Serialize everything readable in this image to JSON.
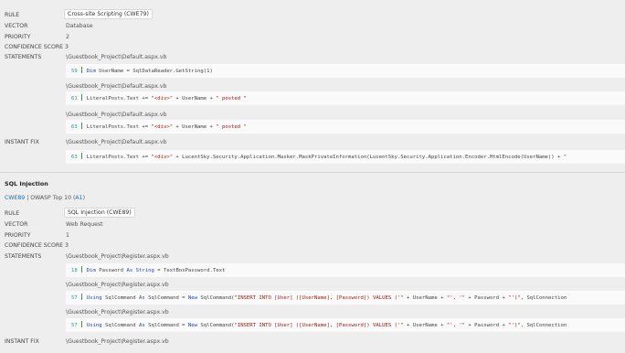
{
  "section1": {
    "rule_label": "RULE",
    "rule_value": "Cross-site Scripting (CWE79)",
    "vector_label": "VECTOR",
    "vector_value": "Database",
    "priority_label": "PRIORITY",
    "priority_value": "2",
    "confidence_label": "CONFIDENCE SCORE",
    "confidence_value": "3",
    "statements_label": "STATEMENTS",
    "statements": [
      {
        "path": "\\Guestbook_Project\\Default.aspx.vb",
        "line": "59",
        "parts": [
          {
            "t": "kw",
            "v": "Dim"
          },
          {
            "t": "txt",
            "v": " UserName = SqlDataReader.GetString(1)"
          }
        ]
      },
      {
        "path": "\\Guestbook_Project\\Default.aspx.vb",
        "line": "61",
        "parts": [
          {
            "t": "txt",
            "v": "LiteralPosts.Text += "
          },
          {
            "t": "str",
            "v": "\"<div>\""
          },
          {
            "t": "txt",
            "v": " + UserName + "
          },
          {
            "t": "str",
            "v": "\" posted \""
          }
        ]
      },
      {
        "path": "\\Guestbook_Project\\Default.aspx.vb",
        "line": "63",
        "parts": [
          {
            "t": "txt",
            "v": "LiteralPosts.Text += "
          },
          {
            "t": "str",
            "v": "\"<div>\""
          },
          {
            "t": "txt",
            "v": " + UserName + "
          },
          {
            "t": "str",
            "v": "\" posted \""
          }
        ]
      }
    ],
    "fix_label": "INSTANT FIX",
    "fix": {
      "path": "\\Guestbook_Project\\Default.aspx.vb",
      "line": "63",
      "parts": [
        {
          "t": "txt",
          "v": "LiteralPosts.Text += "
        },
        {
          "t": "str",
          "v": "\"<div>\""
        },
        {
          "t": "txt",
          "v": " + LucentSky.Security.Application.Masker.MaskPrivateInformation(LucentSky.Security.Application.Encoder.HtmlEncode(UserName)) + \""
        }
      ]
    }
  },
  "section2": {
    "title": "SQL Injection",
    "cwe_link": "CWE89",
    "tags_sep": " | OWASP Top 10 (",
    "owasp_link": "A1",
    "tags_end": ")",
    "rule_label": "RULE",
    "rule_value": "SQL Injection (CWE89)",
    "vector_label": "VECTOR",
    "vector_value": "Web Request",
    "priority_label": "PRIORITY",
    "priority_value": "1",
    "confidence_label": "CONFIDENCE SCORE",
    "confidence_value": "3",
    "statements_label": "STATEMENTS",
    "statements": [
      {
        "path": "\\Guestbook_Project\\Register.aspx.vb",
        "line": "18",
        "parts": [
          {
            "t": "kw",
            "v": "Dim"
          },
          {
            "t": "txt",
            "v": " Password "
          },
          {
            "t": "kw",
            "v": "As"
          },
          {
            "t": "txt",
            "v": " "
          },
          {
            "t": "kw",
            "v": "String"
          },
          {
            "t": "txt",
            "v": " = TextBoxPassword.Text"
          }
        ]
      },
      {
        "path": "\\Guestbook_Project\\Register.aspx.vb",
        "line": "57",
        "parts": [
          {
            "t": "kw",
            "v": "Using"
          },
          {
            "t": "txt",
            "v": " SqlCommand "
          },
          {
            "t": "kw",
            "v": "As"
          },
          {
            "t": "txt",
            "v": " SqlCommand = "
          },
          {
            "t": "kw",
            "v": "New"
          },
          {
            "t": "txt",
            "v": " SqlCommand("
          },
          {
            "t": "str",
            "v": "\"INSERT INTO [User] ([UserName], [Password]) VALUES ('\""
          },
          {
            "t": "txt",
            "v": " + UserName + "
          },
          {
            "t": "str",
            "v": "\"', '\""
          },
          {
            "t": "txt",
            "v": " + Password + "
          },
          {
            "t": "str",
            "v": "\"')\""
          },
          {
            "t": "txt",
            "v": ", SqlConnection"
          }
        ]
      },
      {
        "path": "\\Guestbook_Project\\Register.aspx.vb",
        "line": "57",
        "parts": [
          {
            "t": "kw",
            "v": "Using"
          },
          {
            "t": "txt",
            "v": " SqlCommand "
          },
          {
            "t": "kw",
            "v": "As"
          },
          {
            "t": "txt",
            "v": " SqlCommand = "
          },
          {
            "t": "kw",
            "v": "New"
          },
          {
            "t": "txt",
            "v": " SqlCommand("
          },
          {
            "t": "str",
            "v": "\"INSERT INTO [User] ([UserName], [Password]) VALUES ('\""
          },
          {
            "t": "txt",
            "v": " + UserName + "
          },
          {
            "t": "str",
            "v": "\"', '\""
          },
          {
            "t": "txt",
            "v": " + Password + "
          },
          {
            "t": "str",
            "v": "\"')\""
          },
          {
            "t": "txt",
            "v": ", SqlConnection"
          }
        ]
      }
    ],
    "fix_label": "INSTANT FIX",
    "fix_path": "\\Guestbook_Project\\Register.aspx.vb"
  }
}
